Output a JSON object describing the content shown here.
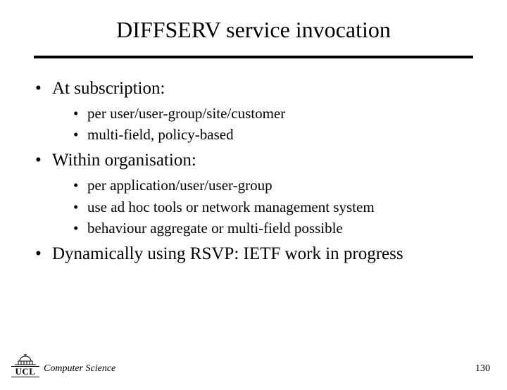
{
  "title": "DIFFSERV service invocation",
  "bullets": [
    {
      "text": "At subscription:",
      "sub": [
        "per user/user-group/site/customer",
        "multi-field, policy-based"
      ]
    },
    {
      "text": "Within organisation:",
      "sub": [
        "per application/user/user-group",
        "use ad hoc tools or network management system",
        "behaviour aggregate or multi-field possible"
      ]
    },
    {
      "text": "Dynamically using RSVP: IETF work in progress",
      "sub": []
    }
  ],
  "footer": {
    "logo_text": "UCL",
    "department": "Computer Science",
    "page_number": "130"
  }
}
